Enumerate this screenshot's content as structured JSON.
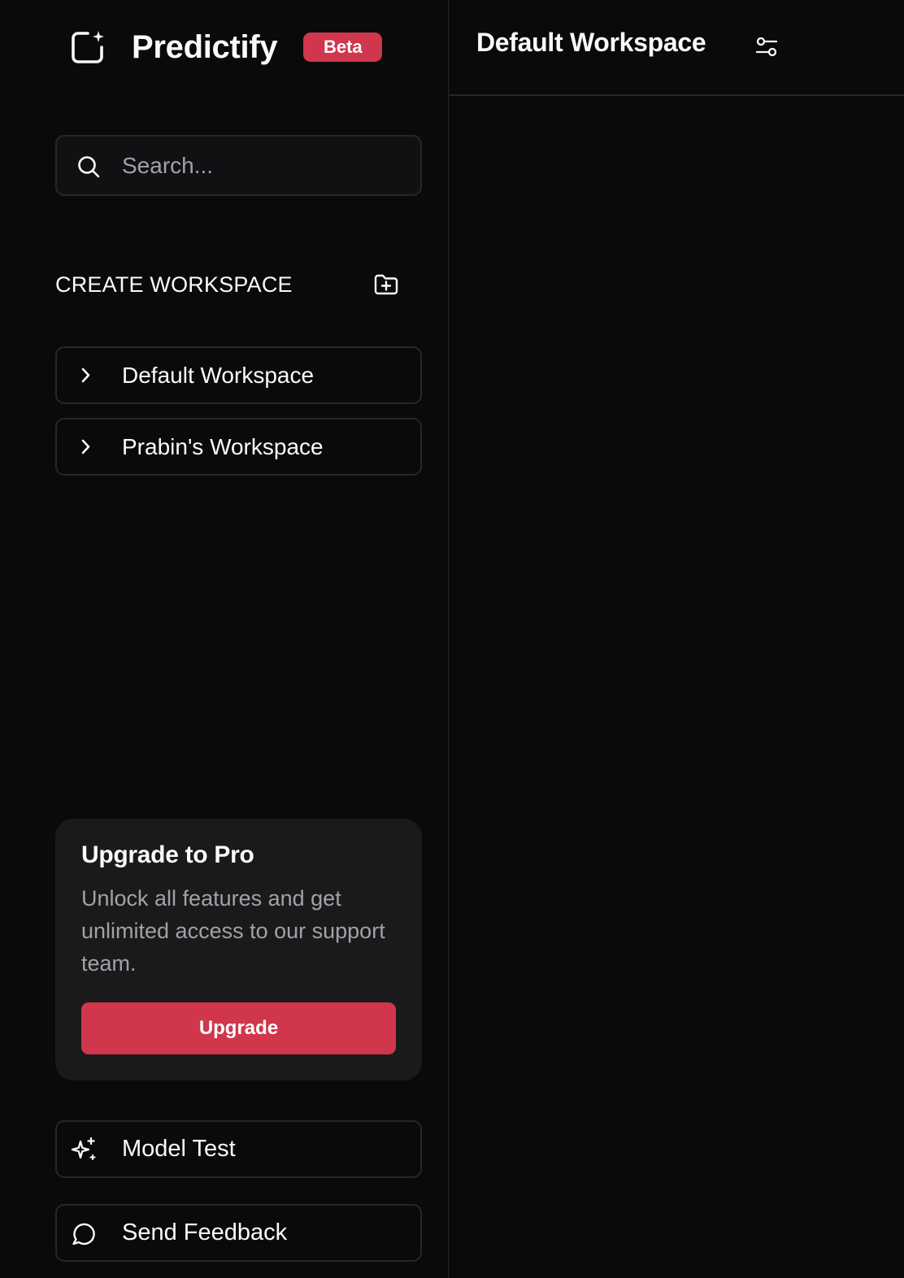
{
  "brand": {
    "name": "Predictify",
    "badge": "Beta"
  },
  "search": {
    "placeholder": "Search..."
  },
  "workspaces": {
    "section_title": "CREATE WORKSPACE",
    "items": [
      {
        "label": "Default Workspace"
      },
      {
        "label": "Prabin's Workspace"
      }
    ]
  },
  "promo": {
    "title": "Upgrade to Pro",
    "text": "Unlock all features and get unlimited access to our support team.",
    "button_label": "Upgrade"
  },
  "footer": {
    "model_test_label": "Model Test",
    "send_feedback_label": "Send Feedback"
  },
  "main": {
    "title": "Default Workspace"
  },
  "colors": {
    "accent": "#d0364c",
    "background": "#0a0a0a",
    "border": "#27272a",
    "card": "#1b1a1a",
    "muted_text": "#a1a1aa"
  }
}
